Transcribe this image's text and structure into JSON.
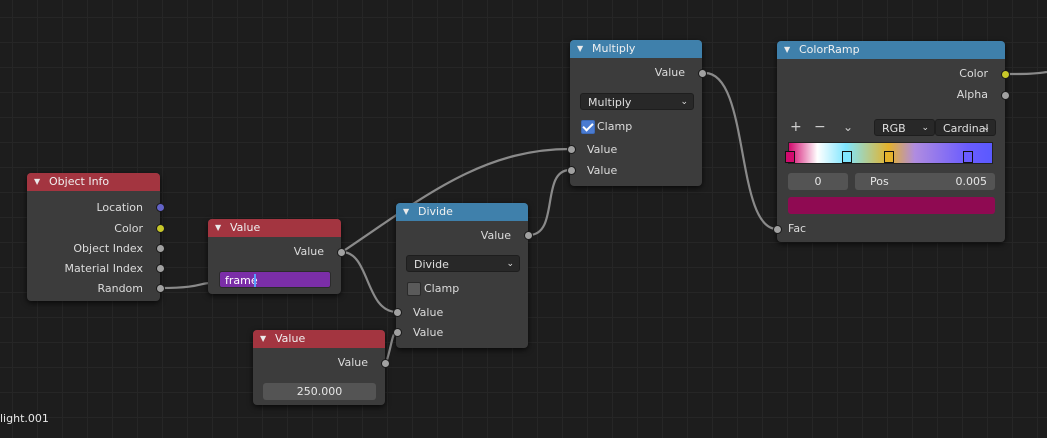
{
  "nodes": {
    "object_info": {
      "title": "Object Info",
      "outputs": [
        "Location",
        "Color",
        "Object Index",
        "Material Index",
        "Random"
      ]
    },
    "value_frame": {
      "title": "Value",
      "output": "Value",
      "field_text": "frame"
    },
    "value_250": {
      "title": "Value",
      "output": "Value",
      "field_value": "250.000"
    },
    "divide": {
      "title": "Divide",
      "output": "Value",
      "operation": "Divide",
      "clamp_label": "Clamp",
      "clamp_checked": false,
      "inputs": [
        "Value",
        "Value"
      ]
    },
    "multiply": {
      "title": "Multiply",
      "output": "Value",
      "operation": "Multiply",
      "clamp_label": "Clamp",
      "clamp_checked": true,
      "inputs": [
        "Value",
        "Value"
      ]
    },
    "colorramp": {
      "title": "ColorRamp",
      "outputs": [
        "Color",
        "Alpha"
      ],
      "add": "+",
      "remove": "−",
      "menu": "⌄",
      "color_mode": "RGB",
      "interpolation": "Cardinal",
      "index_value": "0",
      "pos_label": "Pos",
      "pos_value": "0.005",
      "input": "Fac",
      "selected_color": "#8f0a52",
      "stops": [
        {
          "position": 0.005,
          "color": "#d30a6e"
        },
        {
          "position": 0.28,
          "color": "#7fe6ff"
        },
        {
          "position": 0.49,
          "color": "#e4b22b"
        },
        {
          "position": 0.88,
          "color": "#6a5cff"
        }
      ]
    }
  },
  "overlay_label": "light.001",
  "colors": {
    "input_header": "#a33540",
    "converter_header": "#3f80ab",
    "socket_gray": "#a1a1a1",
    "socket_blue": "#6363c7",
    "socket_yellow": "#c7c729",
    "wire": "#8c8c8c",
    "field_purple": "#7b2ea8"
  }
}
